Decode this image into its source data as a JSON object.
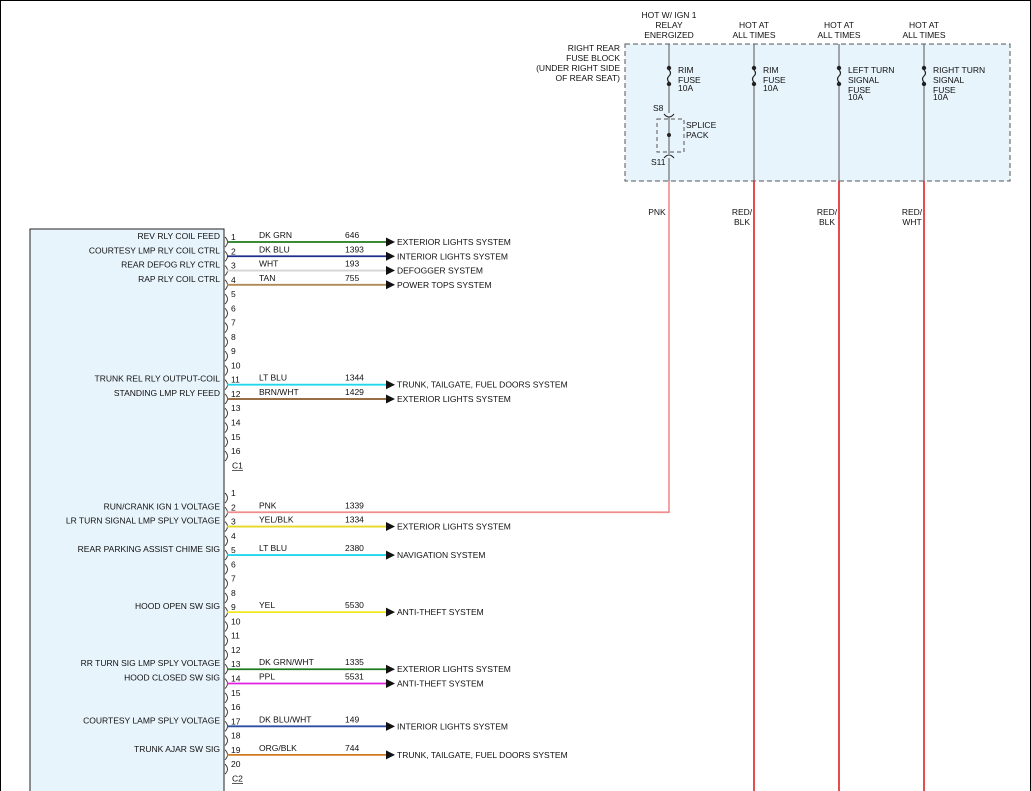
{
  "header_labels": [
    {
      "lines": [
        "HOT W/ IGN 1",
        "RELAY",
        "ENERGIZED"
      ]
    },
    {
      "lines": [
        "HOT AT",
        "ALL TIMES"
      ]
    },
    {
      "lines": [
        "HOT AT",
        "ALL TIMES"
      ]
    },
    {
      "lines": [
        "HOT AT",
        "ALL TIMES"
      ]
    }
  ],
  "fuse_block_label": [
    "RIGHT REAR",
    "FUSE BLOCK",
    "(UNDER RIGHT SIDE",
    "OF REAR SEAT)"
  ],
  "fuses": [
    {
      "lines": [
        "RIM",
        "FUSE",
        "10A"
      ]
    },
    {
      "lines": [
        "RIM",
        "FUSE",
        "10A"
      ]
    },
    {
      "lines": [
        "LEFT TURN",
        "SIGNAL",
        "FUSE",
        "10A"
      ]
    },
    {
      "lines": [
        "RIGHT TURN",
        "SIGNAL",
        "FUSE",
        "10A"
      ]
    }
  ],
  "splice": {
    "top": "S8",
    "bottom": "S11",
    "label": [
      "SPLICE",
      "PACK"
    ]
  },
  "vertical_wires": [
    {
      "label": [
        "PNK"
      ],
      "color": "#f08c8c"
    },
    {
      "label": [
        "RED/",
        "BLK"
      ],
      "color": "#e02020"
    },
    {
      "label": [
        "RED/",
        "BLK"
      ],
      "color": "#e02020"
    },
    {
      "label": [
        "RED/",
        "WHT"
      ],
      "color": "#e02020"
    }
  ],
  "connectors": [
    {
      "name": "C1",
      "pins": [
        {
          "pin": "1",
          "func": "REV RLY COIL FEED",
          "wire": "DK GRN",
          "circuit": "646",
          "color": "#1e7a1e",
          "dest": "EXTERIOR LIGHTS SYSTEM"
        },
        {
          "pin": "2",
          "func": "COURTESY LMP RLY COIL CTRL",
          "wire": "DK BLU",
          "circuit": "1393",
          "color": "#1c2f8c",
          "dest": "INTERIOR LIGHTS SYSTEM"
        },
        {
          "pin": "3",
          "func": "REAR DEFOG RLY CTRL",
          "wire": "WHT",
          "circuit": "193",
          "color": "#d4d4d4",
          "dest": "DEFOGGER SYSTEM"
        },
        {
          "pin": "4",
          "func": "RAP RLY COIL CTRL",
          "wire": "TAN",
          "circuit": "755",
          "color": "#b08a55",
          "dest": "POWER TOPS SYSTEM"
        },
        {
          "pin": "5"
        },
        {
          "pin": "6"
        },
        {
          "pin": "7"
        },
        {
          "pin": "8"
        },
        {
          "pin": "9"
        },
        {
          "pin": "10"
        },
        {
          "pin": "11",
          "func": "TRUNK REL RLY OUTPUT-COIL",
          "wire": "LT BLU",
          "circuit": "1344",
          "color": "#22d6ee",
          "dest": "TRUNK, TAILGATE, FUEL DOORS SYSTEM"
        },
        {
          "pin": "12",
          "func": "STANDING LMP RLY FEED",
          "wire": "BRN/WHT",
          "circuit": "1429",
          "color": "#8a5a2a",
          "dest": "EXTERIOR LIGHTS SYSTEM"
        },
        {
          "pin": "13"
        },
        {
          "pin": "14"
        },
        {
          "pin": "15"
        },
        {
          "pin": "16"
        }
      ]
    },
    {
      "name": "C2",
      "pins": [
        {
          "pin": "1"
        },
        {
          "pin": "2",
          "func": "RUN/CRANK IGN 1 VOLTAGE",
          "wire": "PNK",
          "circuit": "1339",
          "color": "#f08c8c",
          "dest": ""
        },
        {
          "pin": "3",
          "func": "LR TURN SIGNAL LMP SPLY VOLTAGE",
          "wire": "YEL/BLK",
          "circuit": "1334",
          "color": "#e8d820",
          "dest": "EXTERIOR LIGHTS SYSTEM"
        },
        {
          "pin": "4"
        },
        {
          "pin": "5",
          "func": "REAR PARKING ASSIST CHIME SIG",
          "wire": "LT BLU",
          "circuit": "2380",
          "color": "#22d6ee",
          "dest": "NAVIGATION SYSTEM"
        },
        {
          "pin": "6"
        },
        {
          "pin": "7"
        },
        {
          "pin": "8"
        },
        {
          "pin": "9",
          "func": "HOOD OPEN SW SIG",
          "wire": "YEL",
          "circuit": "5530",
          "color": "#f0e820",
          "dest": "ANTI-THEFT SYSTEM"
        },
        {
          "pin": "10"
        },
        {
          "pin": "11"
        },
        {
          "pin": "12"
        },
        {
          "pin": "13",
          "func": "RR TURN SIG LMP SPLY VOLTAGE",
          "wire": "DK GRN/WHT",
          "circuit": "1335",
          "color": "#1e7a1e",
          "dest": "EXTERIOR LIGHTS SYSTEM"
        },
        {
          "pin": "14",
          "func": "HOOD CLOSED SW SIG",
          "wire": "PPL",
          "circuit": "5531",
          "color": "#e020e0",
          "dest": "ANTI-THEFT SYSTEM"
        },
        {
          "pin": "15"
        },
        {
          "pin": "16"
        },
        {
          "pin": "17",
          "func": "COURTESY LAMP SPLY VOLTAGE",
          "wire": "DK BLU/WHT",
          "circuit": "149",
          "color": "#2e4fa0",
          "dest": "INTERIOR LIGHTS SYSTEM"
        },
        {
          "pin": "18"
        },
        {
          "pin": "19",
          "func": "TRUNK AJAR SW SIG",
          "wire": "ORG/BLK",
          "circuit": "744",
          "color": "#d07a20",
          "dest": "TRUNK, TAILGATE, FUEL DOORS SYSTEM"
        },
        {
          "pin": "20"
        }
      ]
    }
  ]
}
